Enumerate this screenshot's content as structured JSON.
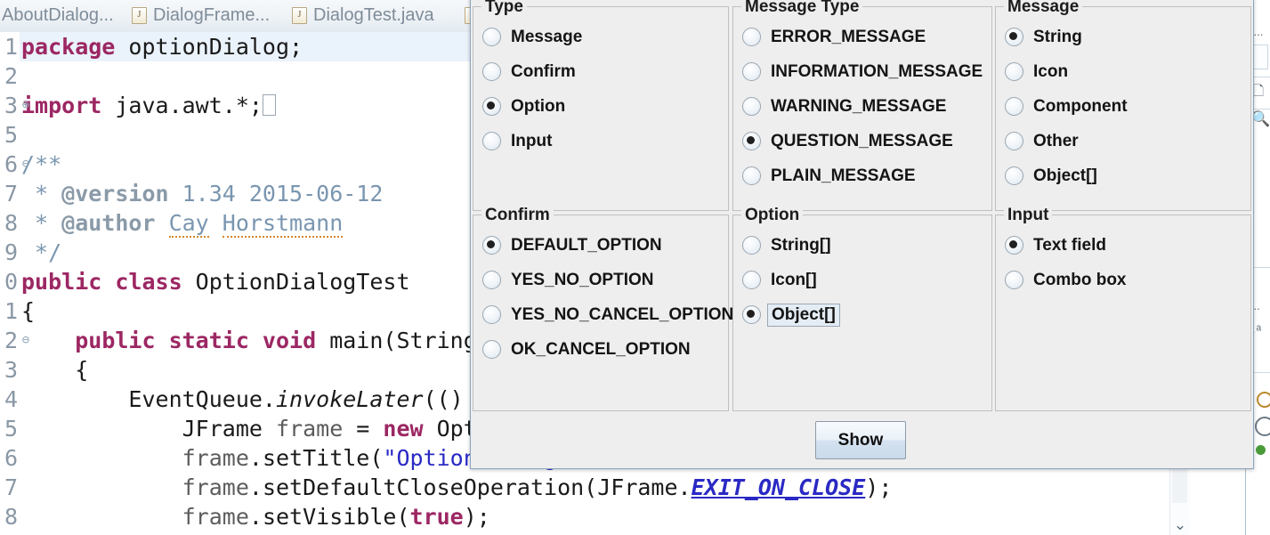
{
  "editor": {
    "tabs": [
      {
        "label": "AboutDialog...",
        "icon": "java-file-icon",
        "active": false,
        "truncated_left": true
      },
      {
        "label": "DialogFrame...",
        "icon": "java-file-icon",
        "active": false
      },
      {
        "label": "DialogTest.java",
        "icon": "java-file-icon",
        "active": false
      },
      {
        "label": "",
        "icon": "java-file-icon",
        "active": false
      }
    ],
    "line_numbers": [
      "1",
      "2",
      "3",
      "5",
      "6",
      "7",
      "8",
      "9",
      "0",
      "1",
      "2",
      "3",
      "4",
      "5",
      "6",
      "7",
      "8"
    ],
    "code_lines": [
      "package optionDialog;",
      "",
      "import java.awt.*;",
      "",
      "/**",
      " * @version 1.34 2015-06-12",
      " * @author Cay Horstmann",
      " */",
      "public class OptionDialogTest",
      "{",
      "    public static void main(String[",
      "    {",
      "        EventQueue.invokeLater(() ->",
      "            JFrame frame = new Option",
      "            frame.setTitle(\"OptionDialogTest\");",
      "            frame.setDefaultCloseOperation(JFrame.EXIT_ON_CLOSE);",
      "            frame.setVisible(true);"
    ],
    "scrollbar": {
      "chevron_icon": "chevron-down-icon"
    }
  },
  "dialog": {
    "show_button": {
      "label": "Show"
    },
    "groups": [
      {
        "title": "Type",
        "name": "type",
        "options": [
          {
            "label": "Message",
            "selected": false
          },
          {
            "label": "Confirm",
            "selected": false
          },
          {
            "label": "Option",
            "selected": true
          },
          {
            "label": "Input",
            "selected": false
          }
        ]
      },
      {
        "title": "Message Type",
        "name": "message-type",
        "options": [
          {
            "label": "ERROR_MESSAGE",
            "selected": false
          },
          {
            "label": "INFORMATION_MESSAGE",
            "selected": false
          },
          {
            "label": "WARNING_MESSAGE",
            "selected": false
          },
          {
            "label": "QUESTION_MESSAGE",
            "selected": true
          },
          {
            "label": "PLAIN_MESSAGE",
            "selected": false
          }
        ]
      },
      {
        "title": "Message",
        "name": "message",
        "options": [
          {
            "label": "String",
            "selected": true
          },
          {
            "label": "Icon",
            "selected": false
          },
          {
            "label": "Component",
            "selected": false
          },
          {
            "label": "Other",
            "selected": false
          },
          {
            "label": "Object[]",
            "selected": false
          }
        ]
      },
      {
        "title": "Confirm",
        "name": "confirm",
        "options": [
          {
            "label": "DEFAULT_OPTION",
            "selected": true
          },
          {
            "label": "YES_NO_OPTION",
            "selected": false
          },
          {
            "label": "YES_NO_CANCEL_OPTION",
            "selected": false
          },
          {
            "label": "OK_CANCEL_OPTION",
            "selected": false
          }
        ]
      },
      {
        "title": "Option",
        "name": "option",
        "options": [
          {
            "label": "String[]",
            "selected": false
          },
          {
            "label": "Icon[]",
            "selected": false
          },
          {
            "label": "Object[]",
            "selected": true,
            "focused": true
          }
        ]
      },
      {
        "title": "Input",
        "name": "input",
        "options": [
          {
            "label": "Text field",
            "selected": true
          },
          {
            "label": "Combo box",
            "selected": false
          }
        ]
      }
    ]
  },
  "right_strip": {
    "fragments": [
      "s...",
      "l..."
    ],
    "icons": [
      "search-icon",
      "outline-icon",
      "sort-icon",
      "circle-icon",
      "status-dot-icon"
    ]
  },
  "colors": {
    "dialog_bg": "#eeeeee",
    "panel_border": "#c0c0c0",
    "accent_blue": "#2a29c4",
    "keyword_magenta": "#9c2763",
    "comment_blue": "#7a96b0",
    "tab_text": "#7f8c99",
    "highlight_line": "#eaf2fb"
  }
}
